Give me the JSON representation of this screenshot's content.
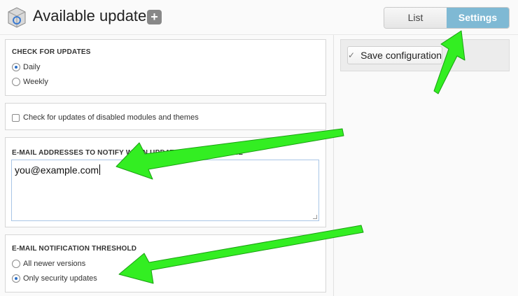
{
  "header": {
    "title": "Available updates",
    "add_label": "+",
    "tabs": [
      {
        "label": "List",
        "active": false
      },
      {
        "label": "Settings",
        "active": true
      }
    ]
  },
  "form": {
    "check_for_updates": {
      "legend": "CHECK FOR UPDATES",
      "options": [
        {
          "label": "Daily",
          "selected": true
        },
        {
          "label": "Weekly",
          "selected": false
        }
      ]
    },
    "disabled_modules": {
      "label": "Check for updates of disabled modules and themes",
      "checked": false
    },
    "email": {
      "legend": "E-MAIL ADDRESSES TO NOTIFY WHEN UPDATES ARE AVAILABLE",
      "value": "you@example.com"
    },
    "threshold": {
      "legend": "E-MAIL NOTIFICATION THRESHOLD",
      "options": [
        {
          "label": "All newer versions",
          "selected": false
        },
        {
          "label": "Only security updates",
          "selected": true
        }
      ]
    }
  },
  "sidebar": {
    "save_label": "Save configuration"
  },
  "colors": {
    "accent_tab": "#7fb9d4",
    "annotation_arrow": "#33ee22",
    "radio_selected": "#2b6fc7"
  }
}
